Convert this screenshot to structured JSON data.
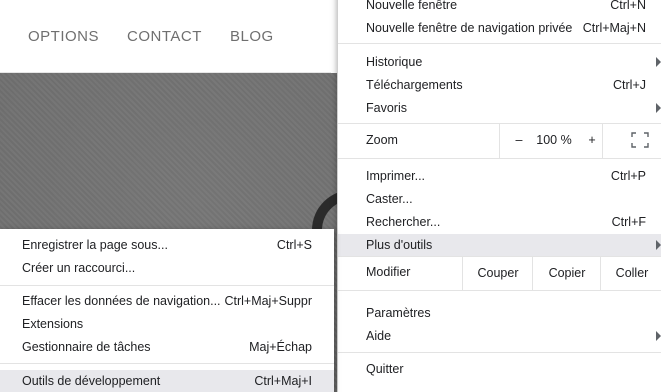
{
  "website": {
    "nav": [
      "OPTIONS",
      "CONTACT",
      "BLOG"
    ]
  },
  "menu": {
    "new_window": {
      "label": "Nouvelle fenêtre",
      "shortcut": "Ctrl+N"
    },
    "incognito": {
      "label": "Nouvelle fenêtre de navigation privée",
      "shortcut": "Ctrl+Maj+N"
    },
    "history": {
      "label": "Historique"
    },
    "downloads": {
      "label": "Téléchargements",
      "shortcut": "Ctrl+J"
    },
    "bookmarks": {
      "label": "Favoris"
    },
    "zoom": {
      "label": "Zoom",
      "minus": "–",
      "value": "100 %",
      "plus": "+"
    },
    "print": {
      "label": "Imprimer...",
      "shortcut": "Ctrl+P"
    },
    "cast": {
      "label": "Caster..."
    },
    "find": {
      "label": "Rechercher...",
      "shortcut": "Ctrl+F"
    },
    "more_tools": {
      "label": "Plus d'outils"
    },
    "edit": {
      "label": "Modifier",
      "cut": "Couper",
      "copy": "Copier",
      "paste": "Coller"
    },
    "settings": {
      "label": "Paramètres"
    },
    "help": {
      "label": "Aide"
    },
    "quit": {
      "label": "Quitter"
    }
  },
  "submenu": {
    "save_page": {
      "label": "Enregistrer la page sous...",
      "shortcut": "Ctrl+S"
    },
    "create_shortcut": {
      "label": "Créer un raccourci..."
    },
    "clear_data": {
      "label": "Effacer les données de navigation...",
      "shortcut": "Ctrl+Maj+Suppr"
    },
    "extensions": {
      "label": "Extensions"
    },
    "task_manager": {
      "label": "Gestionnaire de tâches",
      "shortcut": "Maj+Échap"
    },
    "dev_tools": {
      "label": "Outils de développement",
      "shortcut": "Ctrl+Maj+I"
    }
  },
  "icons": {
    "fullscreen": "fullscreen-icon",
    "submenu_arrow": "chevron-right-icon"
  },
  "colors": {
    "highlight": "#e8e8ec",
    "hero_bg": "#6e6e6e"
  }
}
